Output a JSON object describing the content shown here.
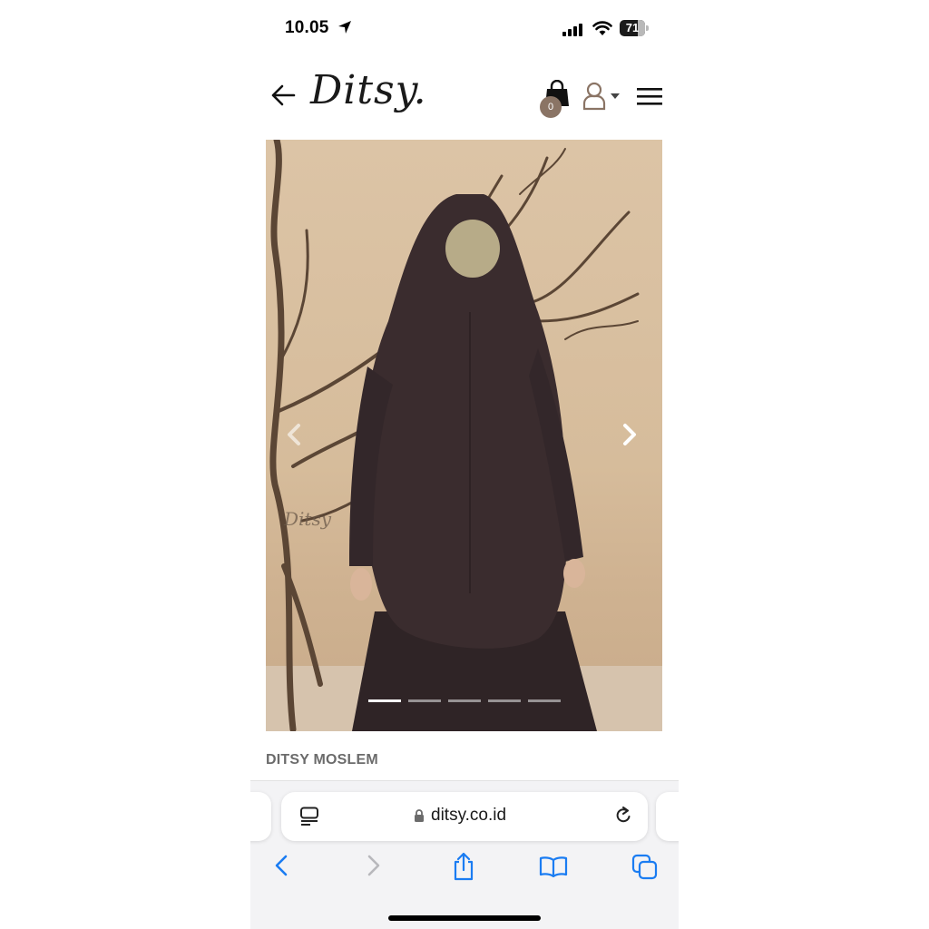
{
  "status_bar": {
    "time": "10.05",
    "battery_level": "71",
    "icons": [
      "location-arrow-icon",
      "cellular-signal-icon",
      "wifi-icon",
      "battery-icon"
    ]
  },
  "header": {
    "logo_text": "Ditsy.",
    "cart_count": "0",
    "icons": [
      "back-arrow-icon",
      "shopping-bag-icon",
      "user-icon",
      "caret-down-icon",
      "hamburger-menu-icon"
    ]
  },
  "product": {
    "image_watermark": "Ditsy",
    "carousel_slide_count": 5,
    "carousel_active_index": 0,
    "brand": "DITSY MOSLEM"
  },
  "browser": {
    "url": "ditsy.co.id",
    "icons": [
      "page-menu-icon",
      "lock-icon",
      "reload-icon",
      "back-icon",
      "forward-icon",
      "share-icon",
      "bookmarks-icon",
      "tabs-icon"
    ]
  },
  "colors": {
    "badge": "#8a7465",
    "accent_blue": "#1a7cf2",
    "garment": "#3a2c2e",
    "backdrop": "#dcc4a6"
  }
}
